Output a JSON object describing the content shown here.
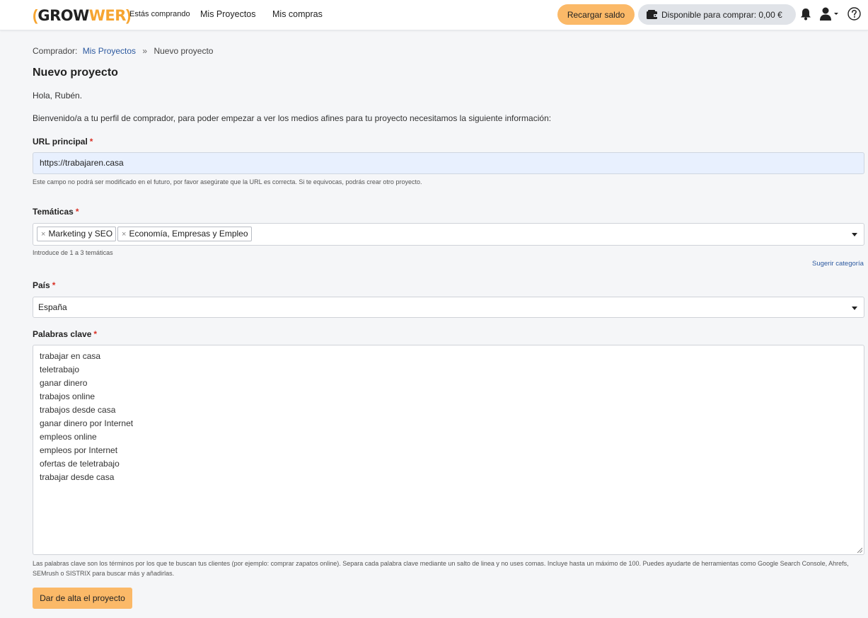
{
  "header": {
    "logo_left": "(",
    "logo_grow": "GROW",
    "logo_wer": "WER",
    "logo_right": ")",
    "mode_label": "Estás comprando",
    "nav": [
      "Mis Proyectos",
      "Mis compras"
    ],
    "recharge_label": "Recargar saldo",
    "balance_label": "Disponible para comprar: 0,00 €",
    "icons": [
      "wallet-icon",
      "bell-icon",
      "user-icon",
      "help-icon"
    ]
  },
  "breadcrumb": {
    "prefix": "Comprador:",
    "link": "Mis Proyectos",
    "separator": "»",
    "current": "Nuevo proyecto"
  },
  "page": {
    "title": "Nuevo proyecto",
    "greeting": "Hola, Rubén.",
    "intro": "Bienvenido/a a tu perfil de comprador, para poder empezar a ver los medios afines para tu proyecto necesitamos la siguiente información:"
  },
  "form": {
    "required_mark": "*",
    "url": {
      "label": "URL principal",
      "value": "https://trabajaren.casa",
      "help": "Este campo no podrá ser modificado en el futuro, por favor asegúrate que la URL es correcta. Si te equivocas, podrás crear otro proyecto."
    },
    "topics": {
      "label": "Temáticas",
      "tags": [
        "Marketing y SEO",
        "Economía, Empresas y Empleo"
      ],
      "remove_symbol": "×",
      "help": "Introduce de 1 a 3 temáticas",
      "suggest_label": "Sugerir categoría"
    },
    "country": {
      "label": "País",
      "selected": "España"
    },
    "keywords": {
      "label": "Palabras clave",
      "values": [
        "trabajar en casa",
        "teletrabajo",
        "ganar dinero",
        "trabajos online",
        "trabajos desde casa",
        "ganar dinero por Internet",
        "empleos online",
        "empleos por Internet",
        "ofertas de teletrabajo",
        "trabajar desde casa"
      ],
      "help": "Las palabras clave son los términos por los que te buscan tus clientes (por ejemplo: comprar zapatos online). Separa cada palabra clave mediante un salto de linea y no uses comas. Incluye hasta un máximo de 100. Puedes ayudarte de herramientas como Google Search Console, Ahrefs, SEMrush o SISTRIX para buscar más y añadirlas."
    },
    "submit_label": "Dar de alta el proyecto"
  },
  "colors": {
    "accent": "#fbb968",
    "brand_orange": "#f6a531",
    "link": "#2d5aa0",
    "url_field_bg": "#e8f0fe"
  }
}
